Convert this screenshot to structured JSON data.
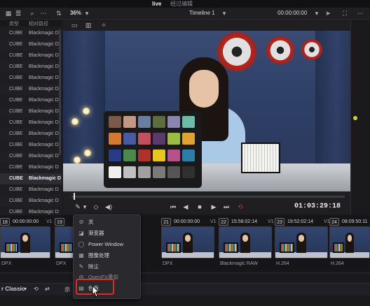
{
  "app": {
    "active_tab": "live",
    "inactive_tab": "经过编辑"
  },
  "toolbar": {
    "zoom": "36%",
    "timeline_name": "Timeline 1",
    "timecode": "00:00:00:00"
  },
  "media_list": {
    "headers": [
      "类型",
      "相对路径"
    ],
    "rows": [
      {
        "type": "CUBE",
        "path": "Blackmagic D"
      },
      {
        "type": "CUBE",
        "path": "Blackmagic D"
      },
      {
        "type": "CUBE",
        "path": "Blackmagic D"
      },
      {
        "type": "CUBE",
        "path": "Blackmagic D"
      },
      {
        "type": "CUBE",
        "path": "Blackmagic D"
      },
      {
        "type": "CUBE",
        "path": "Blackmagic D"
      },
      {
        "type": "CUBE",
        "path": "Blackmagic D"
      },
      {
        "type": "CUBE",
        "path": "Blackmagic D"
      },
      {
        "type": "CUBE",
        "path": "Blackmagic D"
      },
      {
        "type": "CUBE",
        "path": "Blackmagic D"
      },
      {
        "type": "CUBE",
        "path": "Blackmagic D"
      },
      {
        "type": "CUBE",
        "path": "Blackmagic D"
      },
      {
        "type": "CUBE",
        "path": "Blackmagic D"
      },
      {
        "type": "CUBE",
        "path": "Blackmagic D"
      },
      {
        "type": "CUBE",
        "path": "Blackmagic D"
      },
      {
        "type": "CUBE",
        "path": "Blackmagic D"
      },
      {
        "type": "CUBE",
        "path": "Blackmagic D"
      }
    ],
    "selected_index": 13
  },
  "viewer": {
    "timecode": "01:03:29:18"
  },
  "clips": [
    {
      "num": "18",
      "tc": "00:00:00:00",
      "track": "V1",
      "caption": "DPX"
    },
    {
      "num": "19",
      "tc": "",
      "track": "",
      "caption": "DPX"
    },
    {
      "num": "21",
      "tc": "00:00:00:00",
      "track": "V1",
      "caption": "DPX"
    },
    {
      "num": "22",
      "tc": "15:58:02:14",
      "track": "V1",
      "caption": "Blackmagic RAW"
    },
    {
      "num": "23",
      "tc": "19:52:02:14",
      "track": "V1",
      "caption": "H.264"
    },
    {
      "num": "24",
      "tc": "08:09:50:11",
      "track": "",
      "caption": "H.264"
    }
  ],
  "bottom": {
    "workspace_label": "r Classic",
    "side_label": "示"
  },
  "context_menu": {
    "items": [
      {
        "icon": "off-icon",
        "glyph": "⊘",
        "label": "关",
        "disabled": false
      },
      {
        "icon": "gradient-icon",
        "glyph": "◪",
        "label": "渐变器",
        "disabled": false
      },
      {
        "icon": "power-window-icon",
        "glyph": "◯",
        "label": "Power Window",
        "disabled": false
      },
      {
        "icon": "mask-icon",
        "glyph": "▦",
        "label": "图像处理",
        "disabled": false
      },
      {
        "icon": "dust-icon",
        "glyph": "✎",
        "label": "除尘",
        "disabled": false
      },
      {
        "icon": "openfx-icon",
        "glyph": "◎",
        "label": "OpenFX叠加",
        "disabled": true
      },
      {
        "icon": "color-chart-icon",
        "glyph": "▤",
        "label": "色板",
        "disabled": false
      }
    ],
    "highlight_color": "#e0291f"
  },
  "colors": {
    "accent_red": "#e0291f",
    "node_green": "#c4d636"
  }
}
